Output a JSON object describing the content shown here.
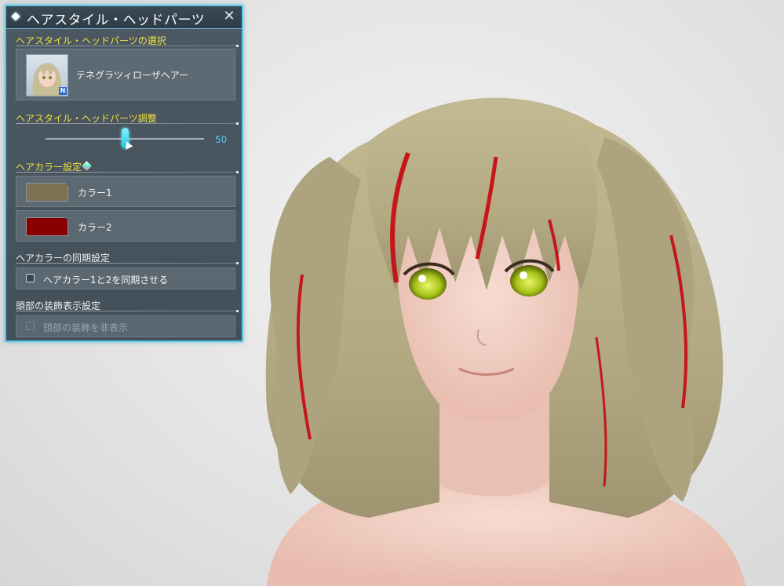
{
  "panel": {
    "title": "ヘアスタイル・ヘッドパーツ",
    "close_label": "✕",
    "selection": {
      "header": "ヘアスタイル・ヘッドパーツの選択",
      "item_name": "テネグラツィローザヘアー",
      "badge": "N"
    },
    "adjust": {
      "header": "ヘアスタイル・ヘッドパーツ調整",
      "value": 50,
      "value_text": "50",
      "min": 0,
      "max": 100
    },
    "hair_color": {
      "header": "ヘアカラー設定",
      "items": [
        {
          "label": "カラー1",
          "color": "#7a7250"
        },
        {
          "label": "カラー2",
          "color": "#8a0000"
        }
      ]
    },
    "sync": {
      "header": "ヘアカラーの同期設定",
      "checkbox_label": "ヘアカラー1と2を同期させる",
      "checked": false
    },
    "head_deco": {
      "header": "頭部の装飾表示設定",
      "checkbox_label": "頭部の装飾を非表示",
      "checked": false,
      "enabled": false
    }
  },
  "colors": {
    "accent": "#58c6e6",
    "header_yellow": "#f0e23c",
    "slider_value": "#52c8ec",
    "hair": "#b7ad86",
    "hair_streak": "#c5161b",
    "skin": "#efcbc1",
    "eye": "#b8d21e"
  }
}
